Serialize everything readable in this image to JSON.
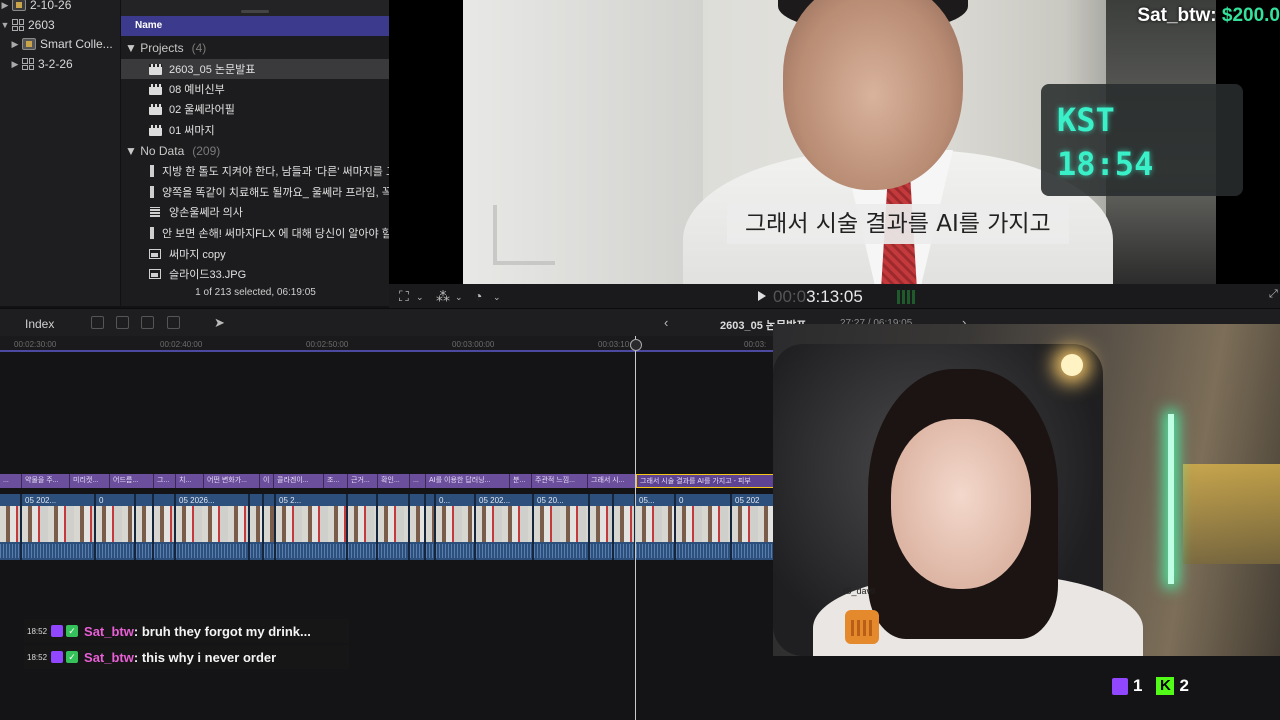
{
  "libraries": [
    {
      "label": "2-10-26",
      "icon": "library-icon",
      "expanded": false
    },
    {
      "label": "2603",
      "icon": "event-grid-icon",
      "expanded": true
    },
    {
      "label": "Smart Colle...",
      "icon": "folder-icon",
      "expanded": false
    },
    {
      "label": "3-2-26",
      "icon": "library-icon",
      "expanded": false
    }
  ],
  "browser": {
    "column_header": "Name",
    "groups": [
      {
        "label": "Projects",
        "count": "(4)"
      },
      {
        "label": "No Data",
        "count": "(209)"
      }
    ],
    "projects": [
      "2603_05 논문발표",
      "08 예비신부",
      "02 울쎄라어필",
      "01 써마지"
    ],
    "items": [
      {
        "label": "지방 한 톨도 지켜야 한다, 남들과 '다른' 써마지를 고",
        "icon": "film-icon"
      },
      {
        "label": "양쪽을 똑같이 치료해도 될까요_ 울쎄라 프라임, 꼭",
        "icon": "film-icon"
      },
      {
        "label": "양손울쎄라 의사",
        "icon": "audio-icon"
      },
      {
        "label": "안 보면 손해! 써마지FLX 에 대해 당신이 알아야 할",
        "icon": "film-icon"
      },
      {
        "label": "써마지 copy",
        "icon": "image-icon"
      },
      {
        "label": "슬라이드33.JPG",
        "icon": "image-icon"
      }
    ],
    "selection_info": "1 of 213 selected, 06:19:05"
  },
  "viewer": {
    "subtitle": "그래서 시술 결과를 AI를 가지고",
    "kst_label": "KST",
    "kst_time": "18:54",
    "donation_user": "Sat_btw: ",
    "donation_amount": "$200.0",
    "timecode_dim": "00:0",
    "timecode": "3:13:05"
  },
  "timeline": {
    "index_label": "Index",
    "project_name": "2603_05 논문발표 ⌄",
    "project_duration": "27:27 / 06:19:05",
    "ruler_ticks": [
      "00:02:30:00",
      "00:02:40:00",
      "00:02:50:00",
      "00:03:00:00",
      "00:03:10:00",
      "00:03:"
    ],
    "titles": [
      "...",
      "약물을 주...",
      "미리캣...",
      "어드름...",
      "그...",
      "치...",
      "어떤 변화가...",
      "이",
      "콜라겐이...",
      "조...",
      "근거...",
      "확인...",
      "...",
      "AI를 이용한 답러닝...",
      "분...",
      "주관적 느낌...",
      "그래서 시...",
      "그래서 시술 결과를 AI를 가지고 - 피부"
    ],
    "clips": [
      "",
      "05 202...",
      "0",
      "",
      "",
      "05 2026...",
      "",
      "",
      "05 2...",
      "",
      "",
      "",
      "",
      "0...",
      "05 202...",
      "05 20...",
      "",
      "",
      "05...",
      "0",
      "05 202"
    ]
  },
  "chat": [
    {
      "time": "18:52",
      "user": "Sat_btw",
      "message": " : bruh they forgot my drink..."
    },
    {
      "time": "18:52",
      "user": "Sat_btw",
      "message": " : this why i never order"
    }
  ],
  "webcam": {
    "overlay_user": "IS_davil"
  },
  "viewer_counts": {
    "twitch": "1",
    "kick": "2",
    "kick_glyph": "K"
  }
}
